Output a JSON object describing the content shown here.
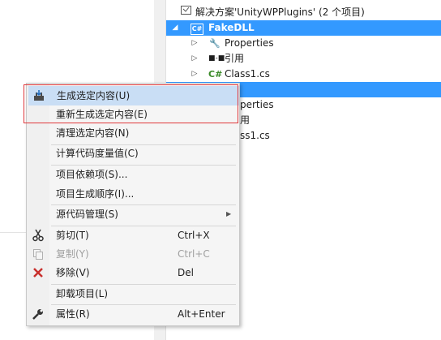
{
  "solution_explorer": {
    "solution_label": "解决方案'UnityWPPlugins' (2 个项目)",
    "project1": {
      "name": "FakeDLL",
      "children": [
        "Properties",
        "引用",
        "Class1.cs"
      ]
    },
    "project2_partial": {
      "children_visible_fragments": [
        "perties",
        "用",
        "ss1.cs"
      ]
    }
  },
  "context_menu": {
    "items": [
      {
        "label": "生成选定内容(U)",
        "shortcut": "",
        "icon": "build-icon",
        "state": "hover"
      },
      {
        "label": "重新生成选定内容(E)",
        "shortcut": "",
        "icon": "",
        "state": "normal"
      },
      {
        "label": "清理选定内容(N)",
        "shortcut": "",
        "icon": "",
        "state": "normal"
      },
      {
        "label": "计算代码度量值(C)",
        "shortcut": "",
        "icon": "",
        "state": "normal"
      },
      {
        "label": "项目依赖项(S)...",
        "shortcut": "",
        "icon": "",
        "state": "normal"
      },
      {
        "label": "项目生成顺序(I)...",
        "shortcut": "",
        "icon": "",
        "state": "normal"
      },
      {
        "label": "源代码管理(S)",
        "shortcut": "",
        "icon": "",
        "state": "submenu"
      },
      {
        "label": "剪切(T)",
        "shortcut": "Ctrl+X",
        "icon": "scissors-icon",
        "state": "normal"
      },
      {
        "label": "复制(Y)",
        "shortcut": "Ctrl+C",
        "icon": "copy-icon",
        "state": "disabled"
      },
      {
        "label": "移除(V)",
        "shortcut": "Del",
        "icon": "delete-icon",
        "state": "normal"
      },
      {
        "label": "卸载项目(L)",
        "shortcut": "",
        "icon": "",
        "state": "normal"
      },
      {
        "label": "属性(R)",
        "shortcut": "Alt+Enter",
        "icon": "wrench-icon",
        "state": "normal"
      }
    ]
  },
  "colors": {
    "selection": "#3399ff",
    "menu_hover": "#c9def5",
    "highlight_border": "#e0393c"
  }
}
